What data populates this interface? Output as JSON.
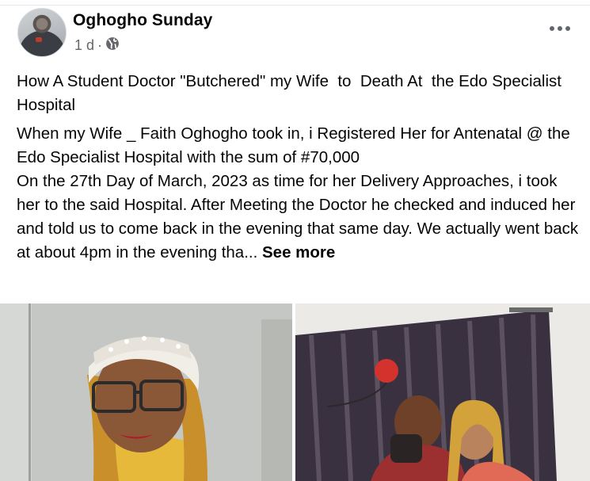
{
  "post": {
    "author": "Oghogho Sunday",
    "time": "1 d",
    "separator": "·",
    "privacy_icon": "globe-icon",
    "more_icon": "more-options-icon",
    "title": "How A Student Doctor \"Butchered\" my Wife  to  Death At  the Edo Specialist Hospital",
    "body": "When  my Wife _ Faith Oghogho took in, i Registered Her for Antenatal @ the Edo Specialist  Hospital with  the  sum of #70,000\nOn the 27th Day of March, 2023 as time for her Delivery  Approaches, i took her to the said Hospital. After  Meeting  the  Doctor he checked and induced her and told us to come back in the evening that same day.  We actually went back at about 4pm in the evening tha...",
    "see_more": "See more"
  },
  "media": {
    "photos": [
      {
        "name": "woman-portrait-photo"
      },
      {
        "name": "couple-photo"
      }
    ]
  },
  "colors": {
    "text": "#050505",
    "secondary": "#65676b",
    "divider": "#e4e6eb"
  }
}
